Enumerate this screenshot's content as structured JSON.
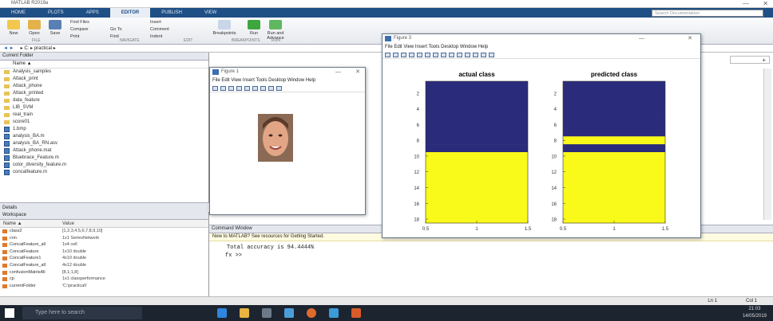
{
  "window": {
    "title": "MATLAB R2019a",
    "minimize": "—",
    "close": "✕"
  },
  "tabs": [
    "HOME",
    "PLOTS",
    "APPS",
    "EDITOR",
    "PUBLISH",
    "VIEW"
  ],
  "search_placeholder": "Search Documentation",
  "ribbon": {
    "buttons": [
      "New",
      "Open",
      "Save",
      "Find Files",
      "Compare",
      "Print",
      "Go To",
      "Find",
      "Insert",
      "Comment",
      "Indent",
      "Breakpoints",
      "Run",
      "Run and Advance"
    ],
    "sections": [
      "FILE",
      "NAVIGATE",
      "EDIT",
      "BREAKPOINTS",
      "RUN"
    ]
  },
  "address": "▸ C: ▸ practical ▸",
  "current_folder": {
    "title": "Current Folder",
    "column": "Name ▲",
    "items": [
      {
        "name": "Analysis_samples",
        "kind": "folder"
      },
      {
        "name": "Attack_print",
        "kind": "folder"
      },
      {
        "name": "Attack_phone",
        "kind": "folder"
      },
      {
        "name": "Attack_printed",
        "kind": "folder"
      },
      {
        "name": "data_feature",
        "kind": "folder"
      },
      {
        "name": "LIB_SVM",
        "kind": "folder"
      },
      {
        "name": "real_train",
        "kind": "folder"
      },
      {
        "name": "score01",
        "kind": "folder"
      },
      {
        "name": "1.bmp",
        "kind": "file"
      },
      {
        "name": "analysis_BA.m",
        "kind": "file"
      },
      {
        "name": "analysis_BA_RN.asv",
        "kind": "file"
      },
      {
        "name": "Attack_phone.mat",
        "kind": "file"
      },
      {
        "name": "Bluebrace_Feature.m",
        "kind": "file"
      },
      {
        "name": "color_diversity_feature.m",
        "kind": "file"
      },
      {
        "name": "concatfeature.m",
        "kind": "file"
      }
    ]
  },
  "details_label": "Details",
  "workspace": {
    "title": "Workspace",
    "headers": [
      "Name ▲",
      "Value"
    ],
    "rows": [
      {
        "name": "class2",
        "value": "[1,2,3,4,5,6,7,8,9,10]"
      },
      {
        "name": "cnn",
        "value": "1x1 SeriesNetwork"
      },
      {
        "name": "ConcatFeature_all",
        "value": "1x4 cell"
      },
      {
        "name": "ConcatFeature",
        "value": "1x10 double"
      },
      {
        "name": "ConcatFeature1",
        "value": "4x10 double"
      },
      {
        "name": "ConcatFeature_all",
        "value": "4x12 double"
      },
      {
        "name": "confusionMatrixAll",
        "value": "[8,1;1,8]"
      },
      {
        "name": "cp",
        "value": "1x1 classperformance"
      },
      {
        "name": "currentFolder",
        "value": "'C:\\practical\\'"
      }
    ]
  },
  "command_window": {
    "title": "Command Window",
    "notice": "New to MATLAB? See resources for Getting Started.",
    "output": "Total accuracy is 94.4444%",
    "prompt": "fx >>"
  },
  "status": {
    "position": "Ln 1",
    "column": "Col 1"
  },
  "figure1": {
    "title": "Figure 1",
    "menu": "File  Edit  View  Insert  Tools  Desktop  Window  Help"
  },
  "figure3": {
    "title": "Figure 3",
    "menu": "File  Edit  View  Insert  Tools  Desktop  Window  Help"
  },
  "taskbar": {
    "search": "Type here to search",
    "time": "21:03",
    "date": "14/05/2019"
  },
  "chart_data": [
    {
      "type": "heatmap",
      "title": "actual class",
      "x": [
        1
      ],
      "yticks": [
        2,
        4,
        6,
        8,
        10,
        12,
        14,
        16,
        18
      ],
      "xticks": [
        "0.5",
        "1",
        "1.5"
      ],
      "ylim": [
        0.5,
        18.5
      ],
      "values": [
        1,
        1,
        1,
        1,
        1,
        1,
        1,
        1,
        1,
        2,
        2,
        2,
        2,
        2,
        2,
        2,
        2,
        2
      ],
      "colors": {
        "1": "#2a2c7b",
        "2": "#f9f91a"
      }
    },
    {
      "type": "heatmap",
      "title": "predicted class",
      "x": [
        1
      ],
      "yticks": [
        2,
        4,
        6,
        8,
        10,
        12,
        14,
        16,
        18
      ],
      "xticks": [
        "0.5",
        "1",
        "1.5"
      ],
      "ylim": [
        0.5,
        18.5
      ],
      "values": [
        1,
        1,
        1,
        1,
        1,
        1,
        1,
        2,
        1,
        2,
        2,
        2,
        2,
        2,
        2,
        2,
        2,
        2
      ],
      "colors": {
        "1": "#2a2c7b",
        "2": "#f9f91a"
      }
    }
  ]
}
